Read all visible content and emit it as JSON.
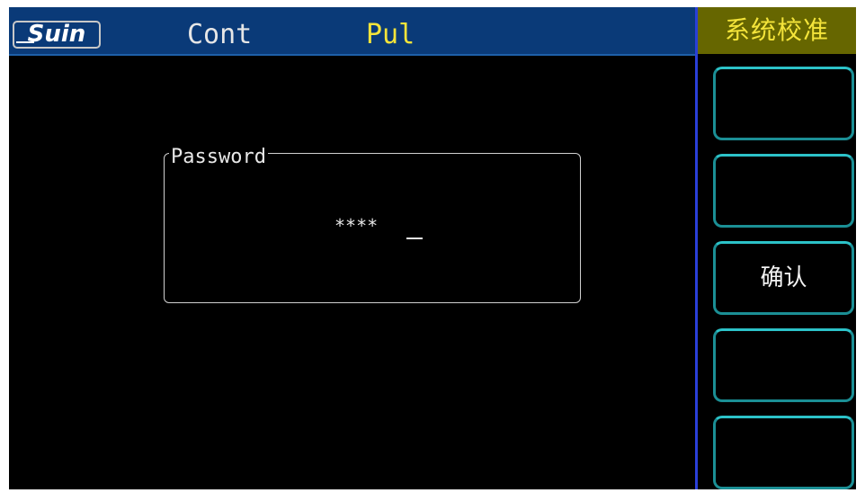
{
  "header": {
    "logo_text": "Suin",
    "mode": "Cont",
    "submode": "Pul"
  },
  "menu": {
    "title": "系统校准",
    "softkeys": [
      "",
      "",
      "确认",
      "",
      ""
    ]
  },
  "password_dialog": {
    "label": "Password",
    "masked_value": "****"
  },
  "colors": {
    "screen_background": "#000000",
    "header_background": "#0a3a78",
    "menu_title_background": "#666600",
    "menu_title_text": "#f4e43a",
    "submode_text": "#f4e43a",
    "softkey_border": "#1b8f95",
    "divider": "#2a3fd8"
  }
}
